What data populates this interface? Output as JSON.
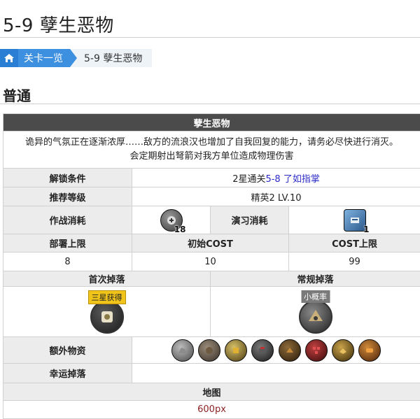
{
  "page": {
    "title": "5-9 孽生恶物"
  },
  "breadcrumb": {
    "home_icon": "home-icon",
    "parent_label": "关卡一览",
    "current_label": "5-9 孽生恶物"
  },
  "section": {
    "heading": "普通"
  },
  "stage": {
    "name": "孽生恶物",
    "description_line1": "诡异的气氛正在逐渐浓厚……敌方的流浪汉也增加了自我回复的能力，请务必尽快进行消灭。",
    "description_line2": "会定期射出弩箭对我方单位造成物理伤害"
  },
  "unlock": {
    "label": "解锁条件",
    "prefix": "2星通关",
    "link": "5-8 了如指掌"
  },
  "level": {
    "label": "推荐等级",
    "value": "精英2 LV.10"
  },
  "cost": {
    "battle_label": "作战消耗",
    "battle_qty": "18",
    "practice_label": "演习消耗",
    "practice_qty": "1"
  },
  "stats": {
    "deploy_label": "部署上限",
    "initial_cost_label": "初始COST",
    "cost_limit_label": "COST上限",
    "deploy_value": "8",
    "initial_cost_value": "10",
    "cost_limit_value": "99"
  },
  "drops": {
    "first_label": "首次掉落",
    "normal_label": "常规掉落",
    "first_tag": "三星获得",
    "normal_tag": "小概率",
    "extra_label": "额外物资",
    "lucky_label": "幸运掉落"
  },
  "extra_items": [
    "ore-icon",
    "device-icon",
    "ester-icon",
    "sugar-icon",
    "polyketone-icon",
    "rock-icon",
    "alloy-icon",
    "gel-icon"
  ],
  "map": {
    "label": "地图",
    "placeholder": "600px"
  },
  "colors": {
    "header_bg": "#4b4b4b",
    "label_bg": "#ececec",
    "breadcrumb_blue": "#3d8fe0",
    "link_blue": "#2b2bc8",
    "map_text": "#8b1f1f"
  }
}
